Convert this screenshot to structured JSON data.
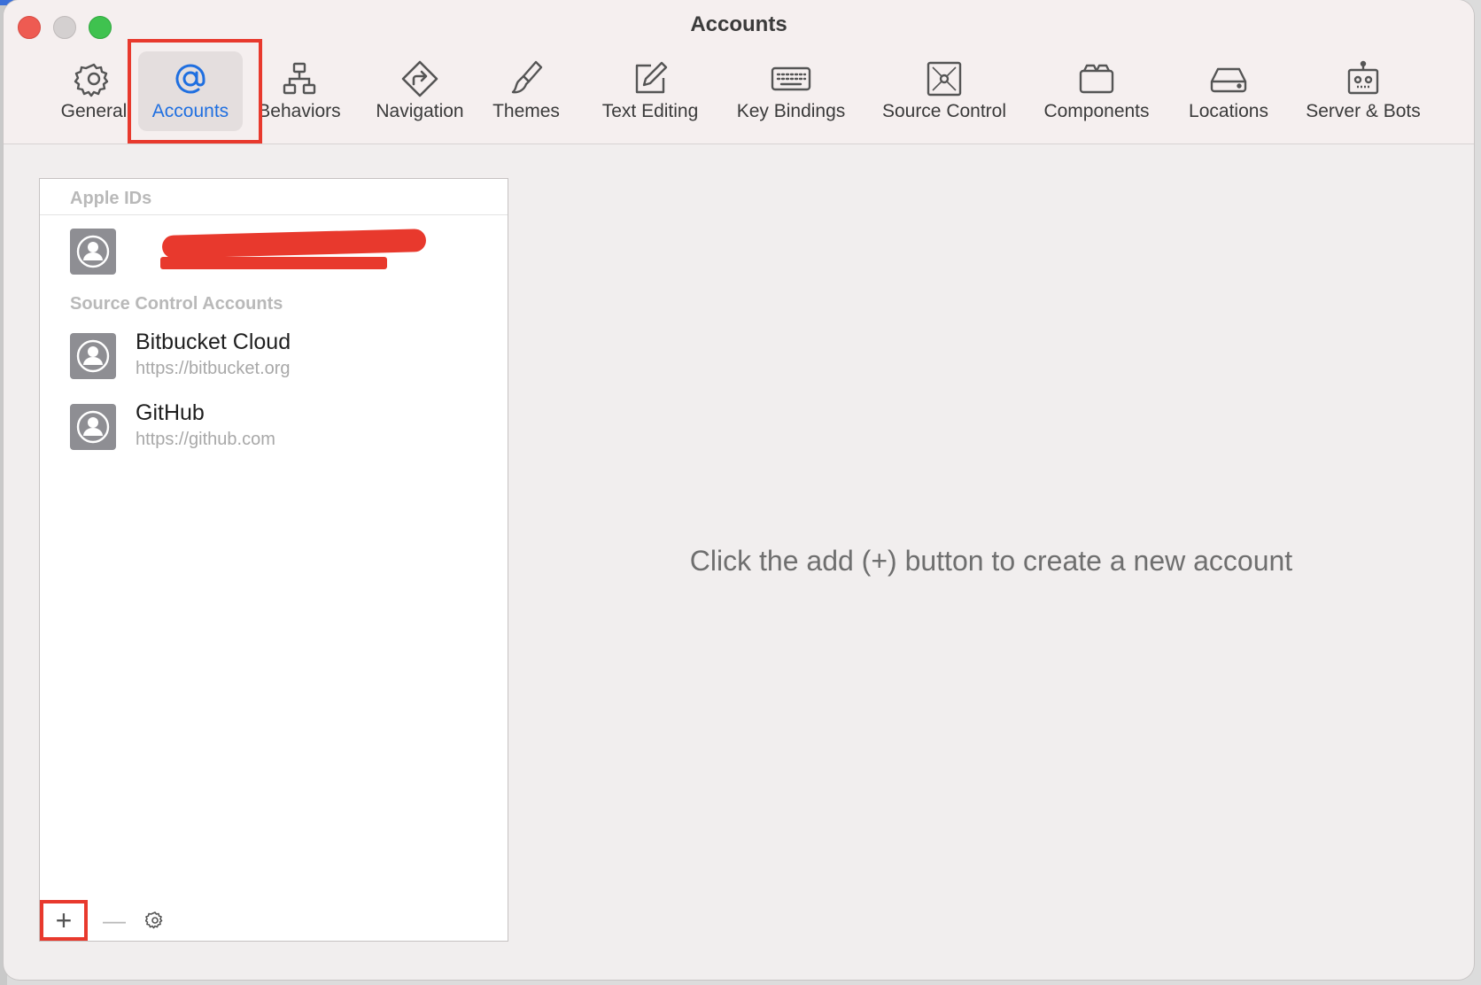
{
  "window": {
    "title": "Accounts"
  },
  "toolbar": {
    "tabs": [
      {
        "label": "General",
        "icon": "gear-icon"
      },
      {
        "label": "Accounts",
        "icon": "at-sign-icon",
        "selected": true
      },
      {
        "label": "Behaviors",
        "icon": "hierarchy-icon"
      },
      {
        "label": "Navigation",
        "icon": "navigation-icon"
      },
      {
        "label": "Themes",
        "icon": "paintbrush-icon"
      },
      {
        "label": "Text Editing",
        "icon": "edit-icon"
      },
      {
        "label": "Key Bindings",
        "icon": "keyboard-icon"
      },
      {
        "label": "Source Control",
        "icon": "source-control-icon"
      },
      {
        "label": "Components",
        "icon": "components-icon"
      },
      {
        "label": "Locations",
        "icon": "drive-icon"
      },
      {
        "label": "Server & Bots",
        "icon": "robot-icon"
      }
    ]
  },
  "accounts_list": {
    "apple_ids_header": "Apple IDs",
    "source_control_header": "Source Control Accounts",
    "source_control_accounts": [
      {
        "name": "Bitbucket Cloud",
        "url": "https://bitbucket.org"
      },
      {
        "name": "GitHub",
        "url": "https://github.com"
      }
    ],
    "add_label": "+",
    "remove_label": "—"
  },
  "main": {
    "empty_message": "Click the add (+) button to create a new account"
  },
  "colors": {
    "accent": "#1f6fe0",
    "highlight_box": "#e8392d",
    "redaction": "#e8392d"
  }
}
